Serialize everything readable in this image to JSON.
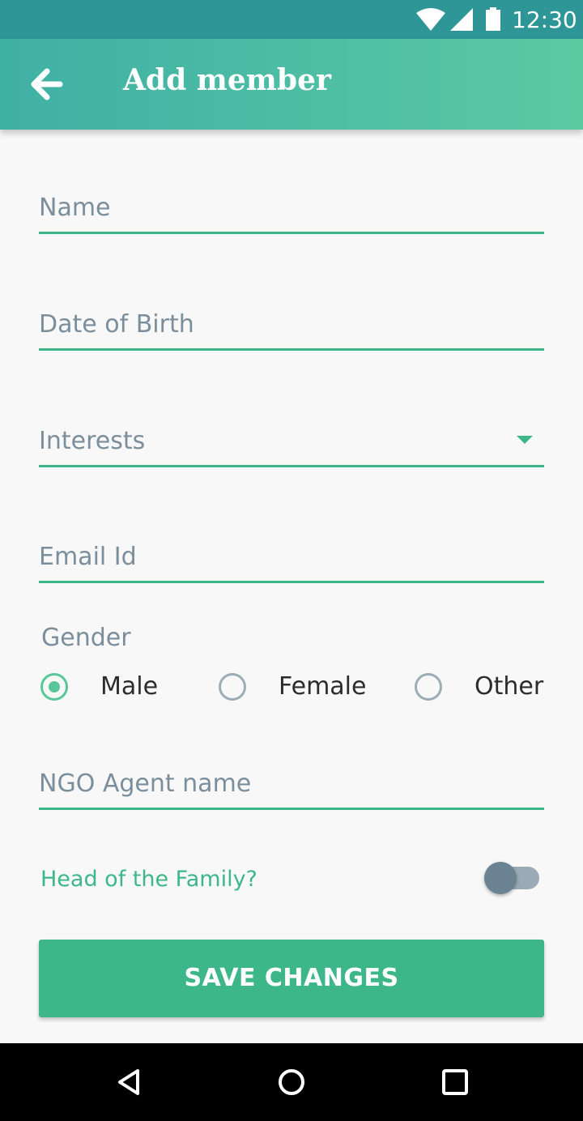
{
  "status_bar": {
    "time": "12:30",
    "icons": [
      "wifi-icon",
      "signal-icon",
      "battery-icon"
    ]
  },
  "app_bar": {
    "title": "Add member",
    "back_icon": "arrow-left-icon"
  },
  "form": {
    "name_placeholder": "Name",
    "dob_placeholder": "Date of Birth",
    "interests_placeholder": "Interests",
    "email_placeholder": "Email Id",
    "gender": {
      "label": "Gender",
      "options": [
        "Male",
        "Female",
        "Other"
      ],
      "selected": "Male"
    },
    "ngo_agent_placeholder": "NGO Agent name",
    "head_of_family": {
      "label": "Head of the Family?",
      "on": false
    },
    "save_label": "SAVE CHANGES"
  },
  "nav_bar": {
    "icons": [
      "back-triangle-icon",
      "home-circle-icon",
      "recents-square-icon"
    ]
  },
  "colors": {
    "accent": "#3db789",
    "status_bar": "#2e9696",
    "app_bar_start": "#3fb0a4",
    "app_bar_end": "#5acaa3",
    "hint_text": "#7b8e9c"
  }
}
